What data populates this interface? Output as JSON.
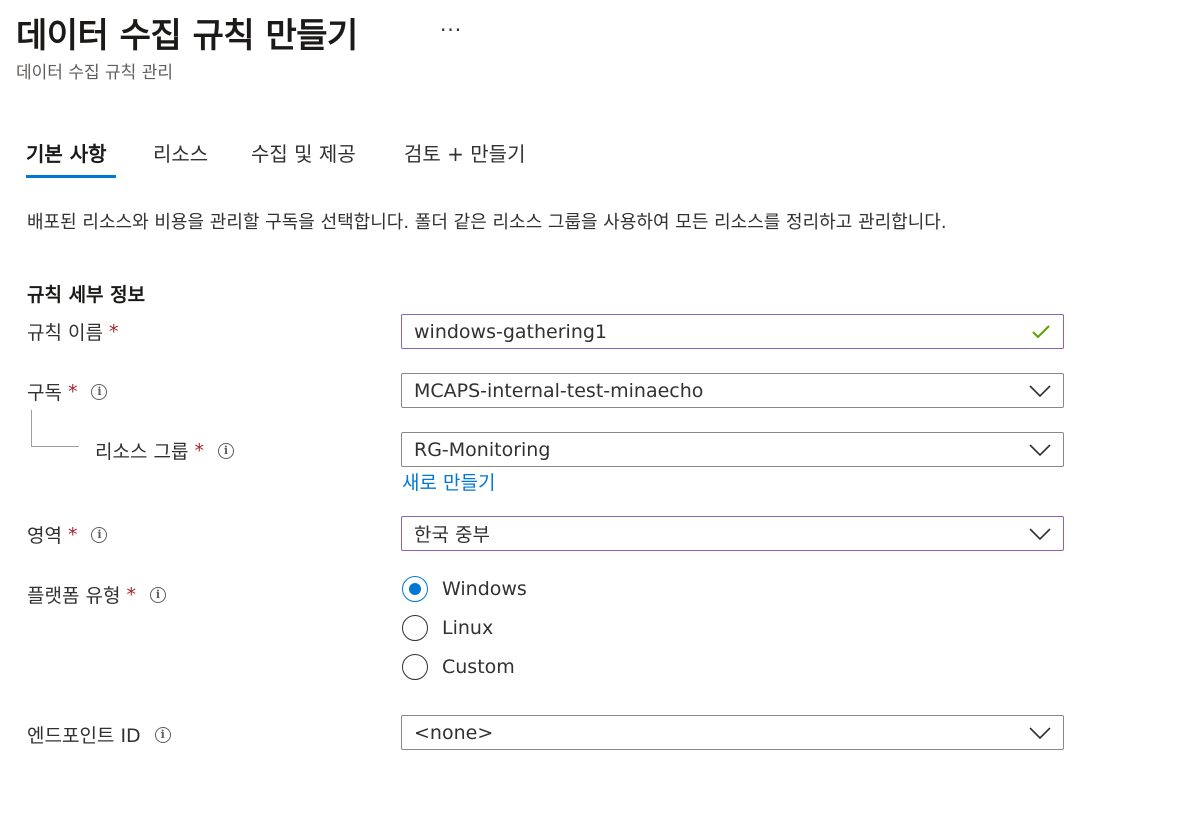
{
  "header": {
    "title": "데이터 수집 규칙 만들기",
    "more": "···",
    "subtitle": "데이터 수집 규칙 관리"
  },
  "tabs": [
    {
      "label": "기본 사항",
      "active": true
    },
    {
      "label": "리소스"
    },
    {
      "label": "수집 및 제공"
    },
    {
      "label": "검토 + 만들기"
    }
  ],
  "description": "배포된 리소스와 비용을 관리할 구독을 선택합니다. 폴더 같은 리소스 그룹을 사용하여 모든 리소스를 정리하고 관리합니다.",
  "section_title": "규칙 세부 정보",
  "form": {
    "rule_name": {
      "label": "규칙 이름",
      "required": "*",
      "value": "windows-gathering1"
    },
    "subscription": {
      "label": "구독",
      "required": "*",
      "value": "MCAPS-internal-test-minaecho"
    },
    "resource_group": {
      "label": "리소스 그룹",
      "required": "*",
      "value": "RG-Monitoring",
      "create_new": "새로 만들기"
    },
    "region": {
      "label": "영역",
      "required": "*",
      "value": "한국 중부"
    },
    "platform": {
      "label": "플랫폼 유형",
      "required": "*",
      "options": [
        "Windows",
        "Linux",
        "Custom"
      ],
      "selected": "Windows"
    },
    "endpoint": {
      "label": "엔드포인트 ID",
      "value": "<none>"
    }
  },
  "colors": {
    "accent": "#0078d4",
    "required": "#a4262c",
    "valid": "#57a300",
    "focus_border": "#8764b8"
  }
}
